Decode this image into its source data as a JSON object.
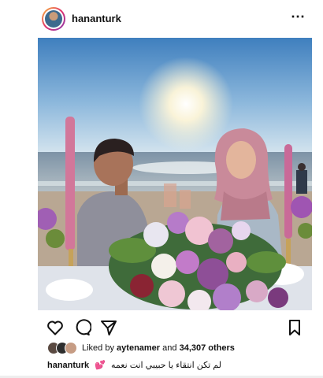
{
  "post": {
    "username": "hananturk",
    "more_icon": "⋯"
  },
  "actions": {
    "like_icon": "heart-icon",
    "comment_icon": "comment-icon",
    "share_icon": "share-icon",
    "save_icon": "bookmark-icon"
  },
  "likes": {
    "prefix": "Liked by",
    "liker": "aytenamer",
    "middle": "and",
    "count": "34,307 others"
  },
  "caption": {
    "username": "hananturk",
    "emoji": "💕",
    "text": "لم تكن انتقاء يا حبيبي انت نعمه"
  },
  "colors": {
    "accent_heart": "#e04a8c",
    "text": "#111111",
    "sky_top": "#5a91c8",
    "sea": "#6f8496"
  }
}
